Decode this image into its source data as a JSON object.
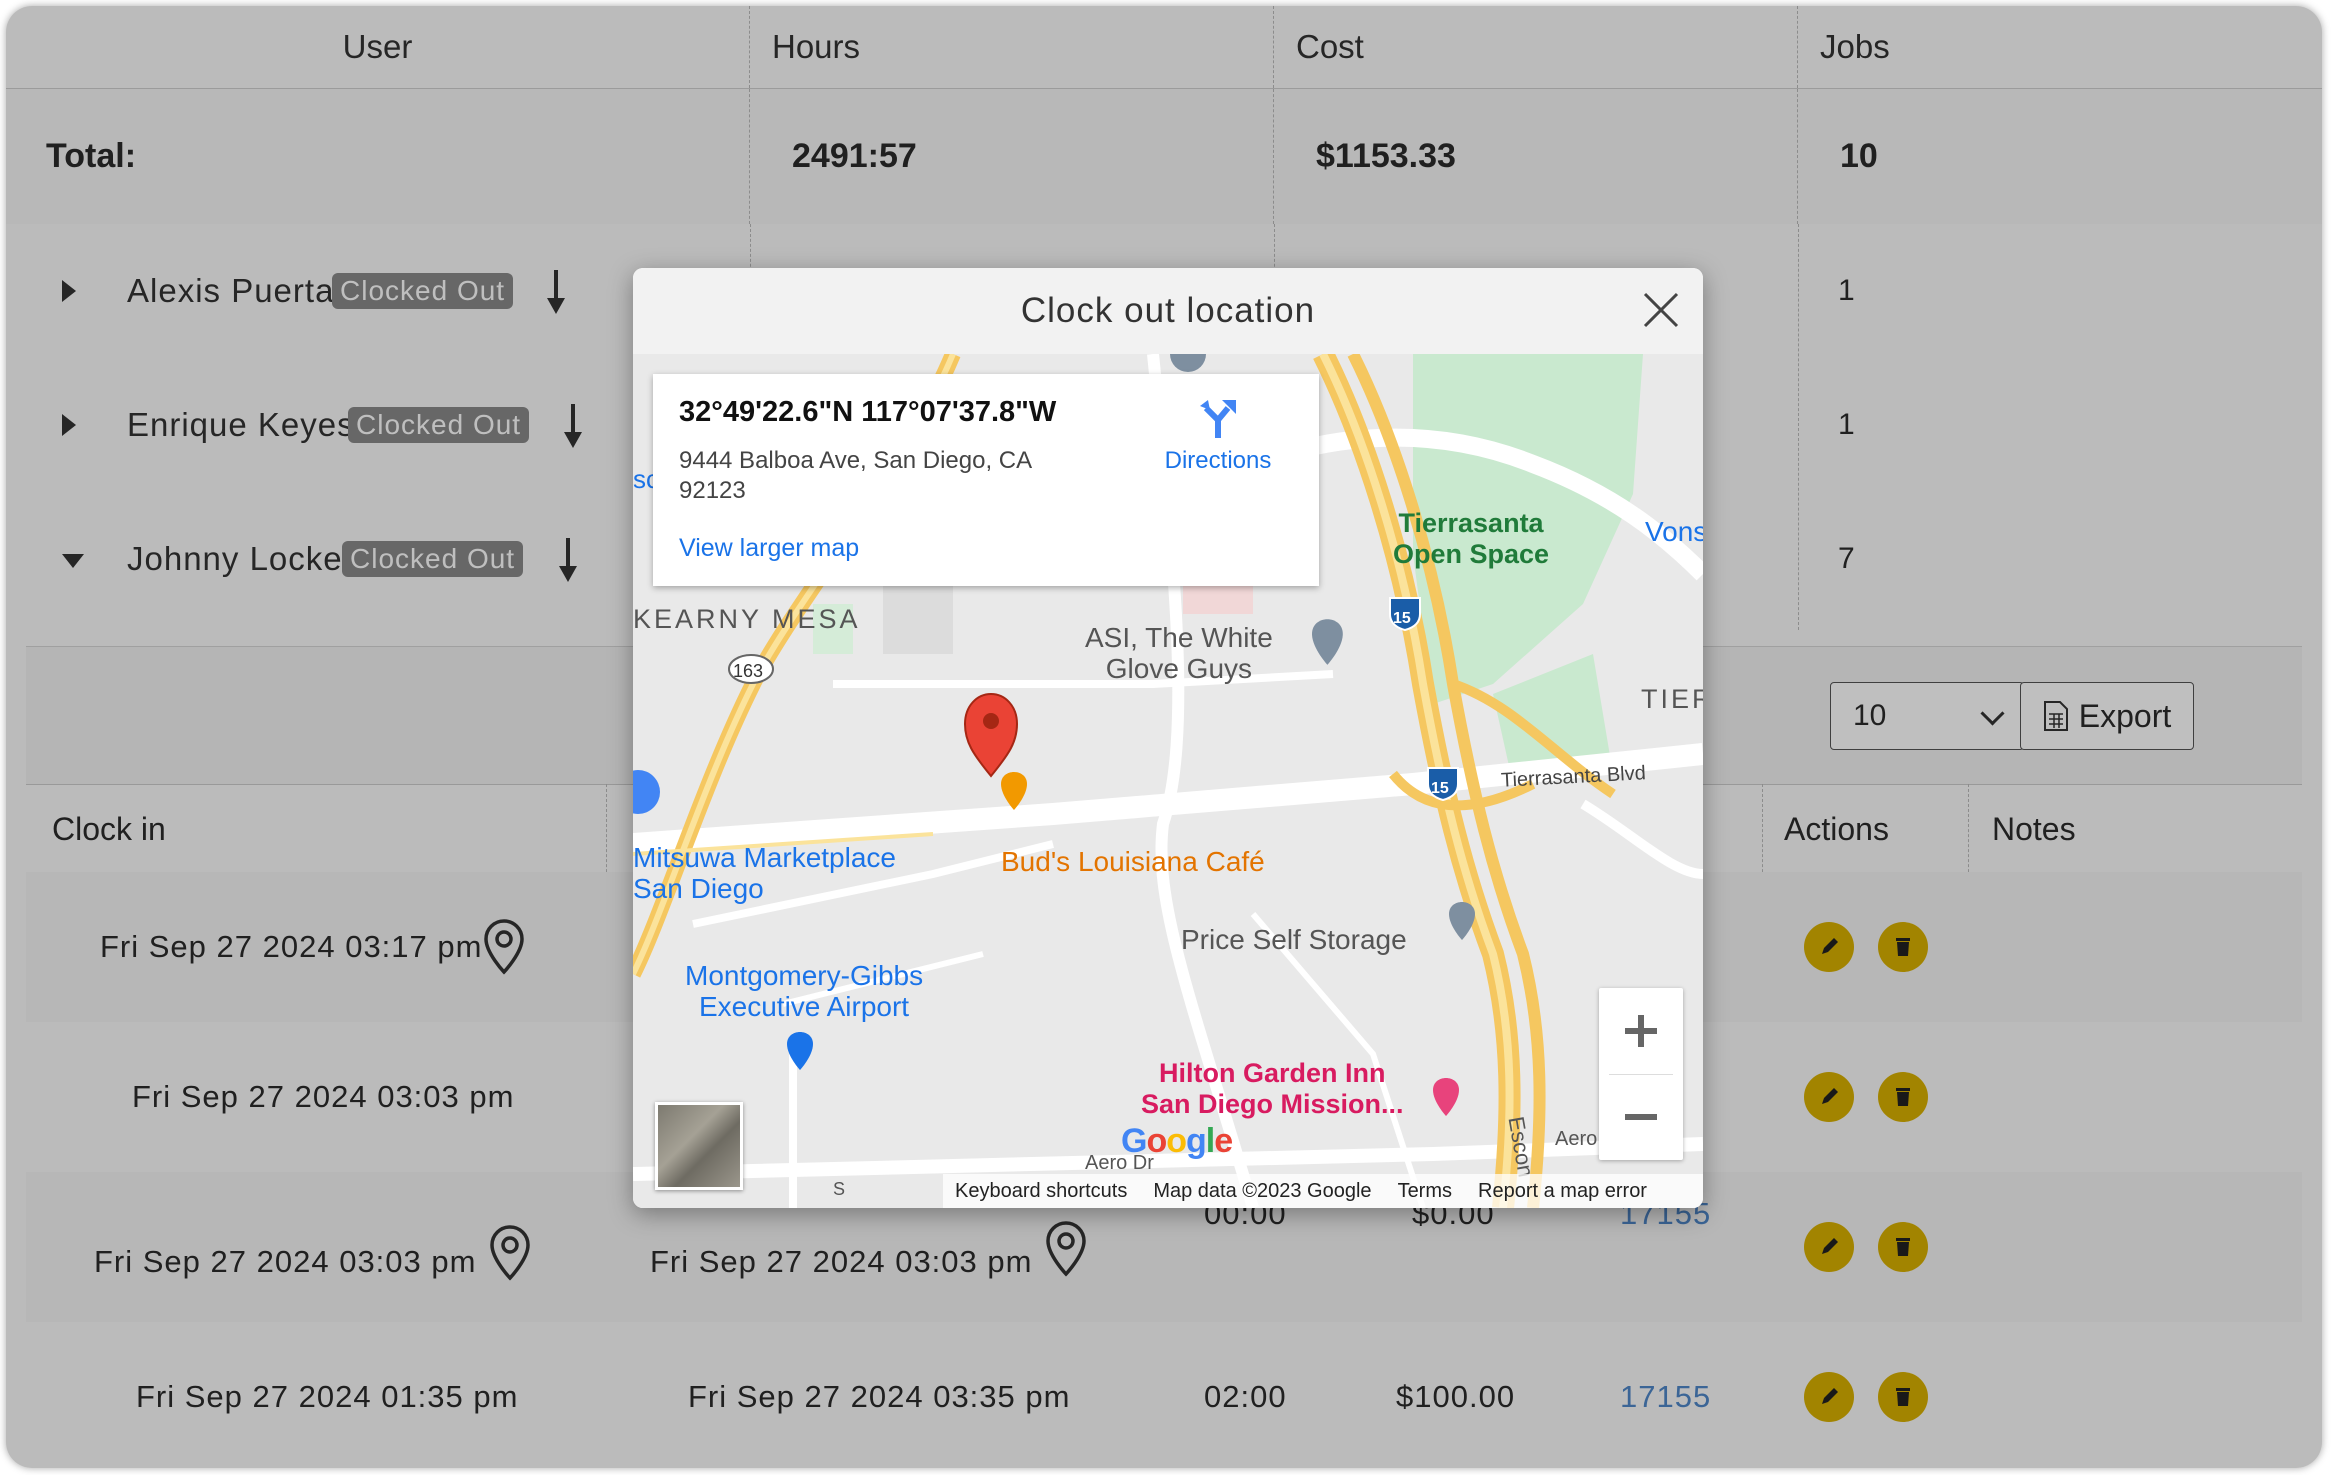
{
  "summary": {
    "headers": {
      "user": "User",
      "hours": "Hours",
      "cost": "Cost",
      "jobs": "Jobs"
    },
    "total": {
      "label": "Total:",
      "hours": "2491:57",
      "cost": "$1153.33",
      "jobs": "10"
    },
    "users": [
      {
        "name": "Alexis Puerta",
        "status": "Clocked Out",
        "jobs": "1",
        "expanded": false
      },
      {
        "name": "Enrique Keyes",
        "status": "Clocked Out",
        "jobs": "1",
        "expanded": false
      },
      {
        "name": "Johnny Locke",
        "status": "Clocked Out",
        "jobs": "7",
        "expanded": true
      }
    ]
  },
  "toolbar": {
    "page_size": "10",
    "export_label": "Export"
  },
  "detail": {
    "headers": {
      "clock_in": "Clock in",
      "actions": "Actions",
      "notes": "Notes"
    },
    "rows": [
      {
        "clock_in": "Fri Sep 27 2024 03:17 pm",
        "clock_out": "",
        "hours": "",
        "cost": "",
        "job": ""
      },
      {
        "clock_in": "Fri Sep 27 2024 03:03 pm",
        "clock_out": "",
        "hours": "",
        "cost": "",
        "job": ""
      },
      {
        "clock_in": "Fri Sep 27 2024 03:03 pm",
        "clock_out": "Fri Sep 27 2024 03:03 pm",
        "hours": "00:00",
        "cost": "$0.00",
        "job": "17155"
      },
      {
        "clock_in": "Fri Sep 27 2024 01:35 pm",
        "clock_out": "Fri Sep 27 2024 03:35 pm",
        "hours": "02:00",
        "cost": "$100.00",
        "job": "17155"
      }
    ]
  },
  "modal": {
    "title": "Clock out location",
    "map": {
      "coords": "32°49'22.6\"N 117°07'37.8\"W",
      "address": "9444 Balboa Ave, San Diego, CA 92123",
      "directions": "Directions",
      "view_larger": "View larger map",
      "labels": {
        "kearny_mesa": "KEARNY MESA",
        "tierrasanta_park_1": "Tierrasanta",
        "tierrasanta_park_2": "Open Space",
        "asi_1": "ASI, The White",
        "asi_2": "Glove Guys",
        "tier": "TIER",
        "vons": "Vons",
        "tierrasanta_blvd": "Tierrasanta Blvd",
        "mitsuwa_1": "Mitsuwa Marketplace",
        "mitsuwa_2": "San Diego",
        "buds": "Bud's Louisiana Café",
        "price_storage": "Price Self Storage",
        "montgomery_1": "Montgomery-Gibbs",
        "montgomery_2": "Executive Airport",
        "hilton_1": "Hilton Garden Inn",
        "hilton_2": "San Diego Mission...",
        "aero_dr": "Aero Dr",
        "aero_dr_2": "Aero",
        "escondido": "Escon",
        "hwy_163": "163",
        "hwy_15": "15",
        "hwy_15b": "15",
        "sd_partial": "S",
        "sc_partial": "sc"
      },
      "footer": {
        "shortcuts": "Keyboard shortcuts",
        "data": "Map data ©2023 Google",
        "terms": "Terms",
        "report": "Report a map error"
      },
      "google": "Google"
    }
  },
  "colors": {
    "accent": "#d8b000",
    "badge": "#8a8a8a",
    "link": "#4f87c9",
    "map_blue": "#1a73e8"
  }
}
